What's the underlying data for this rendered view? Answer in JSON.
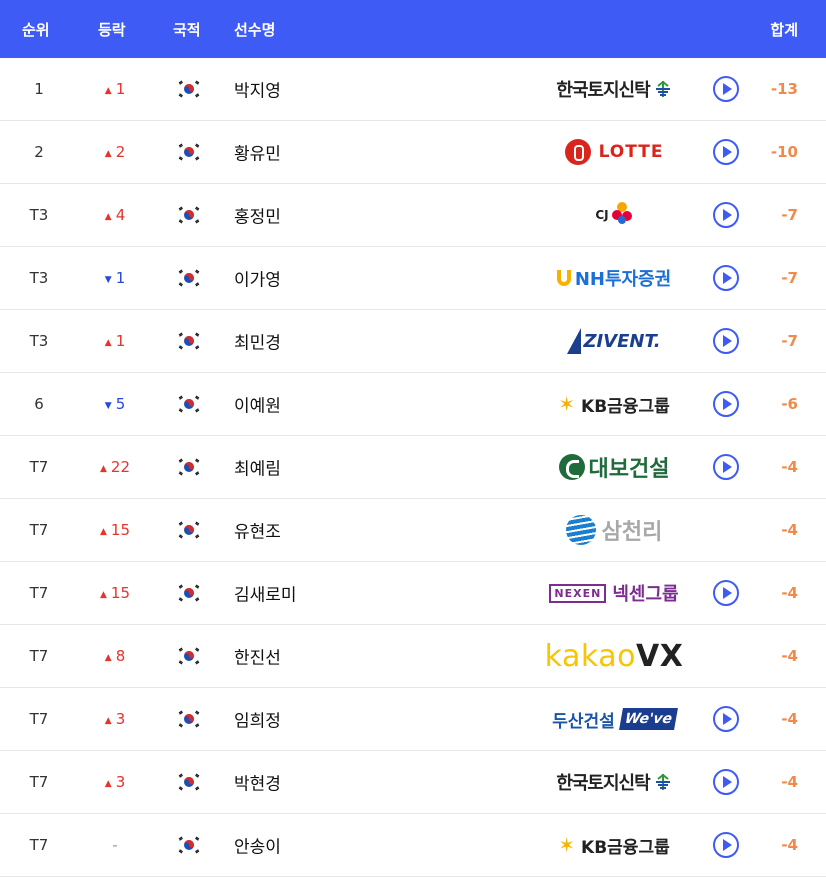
{
  "header": {
    "rank": "순위",
    "move": "등락",
    "nation": "국적",
    "player": "선수명",
    "total": "합계"
  },
  "rows": [
    {
      "rank": "1",
      "dir": "up",
      "move": "1",
      "name": "박지영",
      "sponsor": "hankook",
      "total": "-13",
      "play": true
    },
    {
      "rank": "2",
      "dir": "up",
      "move": "2",
      "name": "황유민",
      "sponsor": "lotte",
      "total": "-10",
      "play": true
    },
    {
      "rank": "T3",
      "dir": "up",
      "move": "4",
      "name": "홍정민",
      "sponsor": "cj",
      "total": "-7",
      "play": true
    },
    {
      "rank": "T3",
      "dir": "down",
      "move": "1",
      "name": "이가영",
      "sponsor": "nh",
      "total": "-7",
      "play": true
    },
    {
      "rank": "T3",
      "dir": "up",
      "move": "1",
      "name": "최민경",
      "sponsor": "ziv",
      "total": "-7",
      "play": true
    },
    {
      "rank": "6",
      "dir": "down",
      "move": "5",
      "name": "이예원",
      "sponsor": "kb",
      "total": "-6",
      "play": true
    },
    {
      "rank": "T7",
      "dir": "up",
      "move": "22",
      "name": "최예림",
      "sponsor": "daebo",
      "total": "-4",
      "play": true
    },
    {
      "rank": "T7",
      "dir": "up",
      "move": "15",
      "name": "유현조",
      "sponsor": "sam",
      "total": "-4",
      "play": false
    },
    {
      "rank": "T7",
      "dir": "up",
      "move": "15",
      "name": "김새로미",
      "sponsor": "nexen",
      "total": "-4",
      "play": true
    },
    {
      "rank": "T7",
      "dir": "up",
      "move": "8",
      "name": "한진선",
      "sponsor": "kakao",
      "total": "-4",
      "play": false
    },
    {
      "rank": "T7",
      "dir": "up",
      "move": "3",
      "name": "임희정",
      "sponsor": "doosan",
      "total": "-4",
      "play": true
    },
    {
      "rank": "T7",
      "dir": "up",
      "move": "3",
      "name": "박현경",
      "sponsor": "hankook",
      "total": "-4",
      "play": true
    },
    {
      "rank": "T7",
      "dir": "none",
      "move": "-",
      "name": "안송이",
      "sponsor": "kb",
      "total": "-4",
      "play": true
    }
  ],
  "sponsors": {
    "hankook": {
      "text": "한국토지신탁"
    },
    "lotte": {
      "text": "LOTTE"
    },
    "cj": {
      "text": "CJ"
    },
    "nh": {
      "text": "NH투자증권"
    },
    "ziv": {
      "text": "ZIVENT."
    },
    "kb": {
      "text": "KB금융그룹"
    },
    "daebo": {
      "text": "대보건설"
    },
    "sam": {
      "text": "삼천리"
    },
    "nexen": {
      "mark": "NEXEN",
      "text": "넥센그룹"
    },
    "kakao": {
      "a": "kakao",
      "b": "VX"
    },
    "doosan": {
      "text": "두산건설",
      "badge": "We've"
    }
  },
  "colors": {
    "header_bg": "#3f5bf5",
    "up": "#e8322d",
    "down": "#2a46e0",
    "total": "#f08a4b"
  },
  "icons": {
    "flag": "korea-flag-icon",
    "play": "play-icon",
    "up": "arrow-up-icon",
    "down": "arrow-down-icon"
  }
}
